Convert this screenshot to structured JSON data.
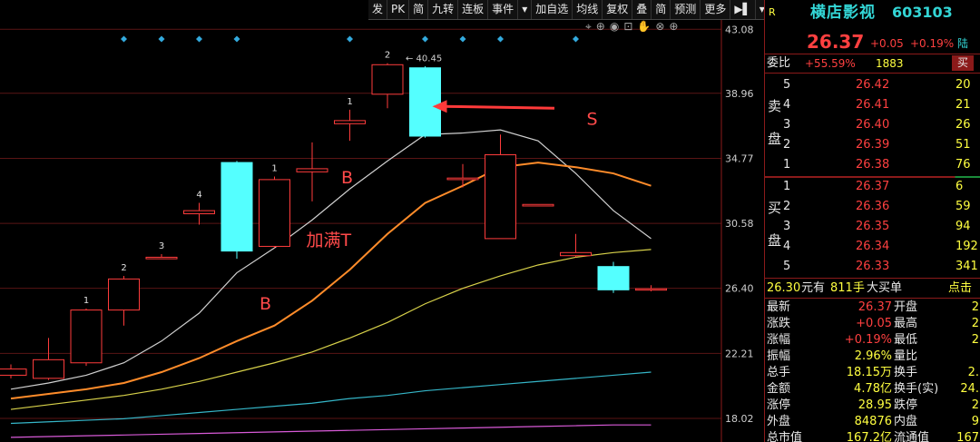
{
  "toolbar": [
    "发",
    "PK",
    "简",
    "九转",
    "连板",
    "事件",
    "▾",
    "加自选",
    "均线",
    "复权",
    "叠",
    "简",
    "预测",
    "更多",
    "▶▌",
    "▾"
  ],
  "icons": [
    "crosshair-icon",
    "zoom-icon",
    "eye-icon",
    "lock-icon",
    "hand-icon",
    "close-circle-icon",
    "add-circle-icon"
  ],
  "chart_data": {
    "type": "candlestick",
    "ylim": [
      16.5,
      44.5
    ],
    "y_ticks": [
      "43.08",
      "38.96",
      "34.77",
      "30.58",
      "26.40",
      "22.21",
      "18.02"
    ],
    "y_tick_values": [
      43.08,
      38.96,
      34.77,
      30.58,
      26.4,
      22.21,
      18.02
    ],
    "candles": [
      {
        "x": 0,
        "open": 20.8,
        "close": 21.2,
        "high": 21.5,
        "low": 20.6
      },
      {
        "x": 1,
        "open": 20.6,
        "close": 21.8,
        "high": 23.2,
        "low": 20.5
      },
      {
        "x": 2,
        "open": 21.6,
        "close": 25.0,
        "high": 25.1,
        "low": 21.4
      },
      {
        "x": 3,
        "open": 25.0,
        "close": 27.0,
        "high": 27.2,
        "low": 24.0
      },
      {
        "x": 4,
        "open": 28.3,
        "close": 28.4,
        "high": 28.6,
        "low": 28.3
      },
      {
        "x": 5,
        "open": 31.2,
        "close": 31.4,
        "high": 31.9,
        "low": 30.5
      },
      {
        "x": 6,
        "open": 34.5,
        "close": 28.8,
        "high": 34.6,
        "low": 28.3
      },
      {
        "x": 7,
        "open": 29.1,
        "close": 33.4,
        "high": 33.6,
        "low": 29.0
      },
      {
        "x": 8,
        "open": 33.9,
        "close": 34.1,
        "high": 35.8,
        "low": 32.0
      },
      {
        "x": 9,
        "open": 37.0,
        "close": 37.2,
        "high": 37.9,
        "low": 35.9
      },
      {
        "x": 10,
        "open": 38.9,
        "close": 40.8,
        "high": 40.9,
        "low": 38.0
      },
      {
        "x": 11,
        "open": 40.6,
        "close": 36.2,
        "high": 40.7,
        "low": 36.1
      },
      {
        "x": 12,
        "open": 33.4,
        "close": 33.5,
        "high": 34.4,
        "low": 32.9
      },
      {
        "x": 13,
        "open": 29.6,
        "close": 35.0,
        "high": 36.3,
        "low": 29.6
      },
      {
        "x": 14,
        "open": 31.7,
        "close": 31.8,
        "high": 31.8,
        "low": 31.7
      },
      {
        "x": 15,
        "open": 28.5,
        "close": 28.7,
        "high": 29.9,
        "low": 28.4
      },
      {
        "x": 16,
        "open": 27.8,
        "close": 26.3,
        "high": 28.1,
        "low": 26.1
      },
      {
        "x": 17,
        "open": 26.3,
        "close": 26.37,
        "high": 26.6,
        "low": 26.2
      }
    ],
    "ma_lines": [
      {
        "name": "MA5",
        "color": "#d0d0d0",
        "values": [
          19.9,
          20.3,
          20.8,
          21.6,
          23.0,
          24.8,
          27.4,
          29.0,
          30.8,
          32.8,
          34.6,
          36.3,
          36.4,
          36.6,
          35.9,
          33.8,
          31.4,
          29.6
        ]
      },
      {
        "name": "MA10",
        "color": "#ff8c2a",
        "values": [
          19.3,
          19.6,
          19.9,
          20.3,
          21.0,
          21.9,
          23.0,
          24.0,
          25.6,
          27.6,
          29.9,
          31.9,
          33.0,
          34.2,
          34.5,
          34.2,
          33.8,
          33.0
        ]
      },
      {
        "name": "MA20",
        "color": "#d8d24a",
        "values": [
          18.6,
          18.9,
          19.2,
          19.5,
          19.9,
          20.4,
          21.0,
          21.6,
          22.3,
          23.2,
          24.2,
          25.4,
          26.4,
          27.2,
          27.9,
          28.4,
          28.7,
          28.9
        ]
      },
      {
        "name": "MA60",
        "color": "#35b6c8",
        "values": [
          17.7,
          17.8,
          17.9,
          18.0,
          18.2,
          18.4,
          18.6,
          18.8,
          19.0,
          19.3,
          19.5,
          19.8,
          20.0,
          20.2,
          20.4,
          20.6,
          20.8,
          21.0
        ]
      },
      {
        "name": "MA120",
        "color": "#d85ad8",
        "values": [
          16.8,
          16.85,
          16.9,
          16.95,
          17.0,
          17.05,
          17.1,
          17.15,
          17.2,
          17.25,
          17.3,
          17.35,
          17.4,
          17.45,
          17.5,
          17.55,
          17.6,
          17.6
        ]
      }
    ],
    "candle_labels": [
      {
        "x": 2,
        "text": "1"
      },
      {
        "x": 3,
        "text": "2"
      },
      {
        "x": 4,
        "text": "3"
      },
      {
        "x": 5,
        "text": "4"
      },
      {
        "x": 7,
        "text": "1"
      },
      {
        "x": 9,
        "text": "1"
      },
      {
        "x": 10,
        "text": "2"
      }
    ],
    "diamond_markers_x": [
      3,
      4,
      5,
      6,
      9,
      11,
      12,
      13,
      15
    ],
    "peak_label": "40.45",
    "annotations": [
      "B",
      "B",
      "加满T",
      "S"
    ]
  },
  "quote": {
    "tag": "R",
    "name": "横店影视",
    "code": "603103",
    "price": "26.37",
    "change": "+0.05",
    "change_pct": "+0.19%",
    "exchange": "陆",
    "weibi_label": "委比",
    "weibi_value": "+55.59%",
    "weicha_value": "1883",
    "sell_button": "买"
  },
  "sell_levels": {
    "label_chars": [
      "卖",
      "盘"
    ],
    "rows": [
      {
        "level": "5",
        "price": "26.42",
        "vol": "20"
      },
      {
        "level": "4",
        "price": "26.41",
        "vol": "21"
      },
      {
        "level": "3",
        "price": "26.40",
        "vol": "26"
      },
      {
        "level": "2",
        "price": "26.39",
        "vol": "51"
      },
      {
        "level": "1",
        "price": "26.38",
        "vol": "76"
      }
    ]
  },
  "buy_levels": {
    "label_chars": [
      "买",
      "盘"
    ],
    "rows": [
      {
        "level": "1",
        "price": "26.37",
        "vol": "6"
      },
      {
        "level": "2",
        "price": "26.36",
        "vol": "59"
      },
      {
        "level": "3",
        "price": "26.35",
        "vol": "94"
      },
      {
        "level": "4",
        "price": "26.34",
        "vol": "192"
      },
      {
        "level": "5",
        "price": "26.33",
        "vol": "341"
      }
    ]
  },
  "big_order": {
    "price": "26.30",
    "yuan_text": "元有",
    "hands": "811手",
    "label": "大买单",
    "link": "点击"
  },
  "stats": [
    {
      "l1": "最新",
      "v1": "26.37",
      "l2": "开盘",
      "v2": "2"
    },
    {
      "l1": "涨跌",
      "v1": "+0.05",
      "l2": "最高",
      "v2": "2"
    },
    {
      "l1": "涨幅",
      "v1": "+0.19%",
      "l2": "最低",
      "v2": "2"
    },
    {
      "l1": "振幅",
      "v1": "2.96%",
      "l2": "量比",
      "v2": ""
    },
    {
      "l1": "总手",
      "v1": "18.15万",
      "l2": "换手",
      "v2": "2."
    },
    {
      "l1": "金额",
      "v1": "4.78亿",
      "l2": "换手(实)",
      "v2": "24."
    },
    {
      "l1": "涨停",
      "v1": "28.95",
      "l2": "跌停",
      "v2": "2"
    },
    {
      "l1": "外盘",
      "v1": "84876",
      "l2": "内盘",
      "v2": "9"
    },
    {
      "l1": "总市值",
      "v1": "167.2亿",
      "l2": "流通值",
      "v2": "167"
    }
  ]
}
